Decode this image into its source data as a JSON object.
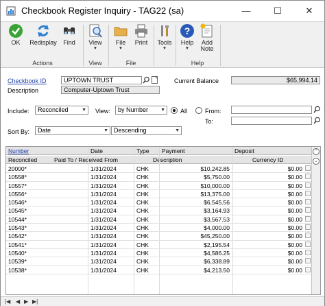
{
  "window": {
    "title": "Checkbook Register Inquiry  -  TAG22 (sa)"
  },
  "ribbon": {
    "buttons": [
      {
        "label": "OK",
        "icon": "check-icon"
      },
      {
        "label": "Redisplay",
        "icon": "refresh-icon"
      },
      {
        "label": "Find",
        "icon": "binoculars-icon"
      },
      {
        "label": "View",
        "icon": "view-icon"
      },
      {
        "label": "File",
        "icon": "folder-icon"
      },
      {
        "label": "Print",
        "icon": "printer-icon"
      },
      {
        "label": "Tools",
        "icon": "tools-icon"
      },
      {
        "label": "Help",
        "icon": "help-icon"
      },
      {
        "label": "Add",
        "label2": "Note",
        "icon": "add-note-icon"
      }
    ],
    "groups": {
      "actions": "Actions",
      "view": "View",
      "file": "File",
      "help": "Help"
    }
  },
  "form": {
    "checkbook_id_label": "Checkbook ID",
    "checkbook_id_value": "UPTOWN TRUST",
    "description_label": "Description",
    "description_value": "Computer-Uptown Trust",
    "current_balance_label": "Current Balance",
    "current_balance_value": "$65,994.14",
    "include_label": "Include:",
    "include_value": "Reconciled",
    "view_label": "View:",
    "view_value": "by Number",
    "all_label": "All",
    "from_label": "From:",
    "to_label": "To:",
    "sort_by_label": "Sort By:",
    "sort_by_value": "Date",
    "sort_order_value": "Descending"
  },
  "grid": {
    "header1": [
      "Number",
      "Date",
      "Type",
      "Payment",
      "Deposit"
    ],
    "header2": [
      "Reconciled",
      "Paid To / Received From",
      "Description",
      "Currency ID"
    ],
    "rows": [
      {
        "number": "20000*",
        "date": "1/31/2024",
        "type": "CHK",
        "payment": "$10,242.85",
        "deposit": "$0.00"
      },
      {
        "number": "10558*",
        "date": "1/31/2024",
        "type": "CHK",
        "payment": "$5,750.00",
        "deposit": "$0.00"
      },
      {
        "number": "10557*",
        "date": "1/31/2024",
        "type": "CHK",
        "payment": "$10,000.00",
        "deposit": "$0.00"
      },
      {
        "number": "10556*",
        "date": "1/31/2024",
        "type": "CHK",
        "payment": "$13,375.00",
        "deposit": "$0.00"
      },
      {
        "number": "10546*",
        "date": "1/31/2024",
        "type": "CHK",
        "payment": "$6,545.56",
        "deposit": "$0.00"
      },
      {
        "number": "10545*",
        "date": "1/31/2024",
        "type": "CHK",
        "payment": "$3,164.93",
        "deposit": "$0.00"
      },
      {
        "number": "10544*",
        "date": "1/31/2024",
        "type": "CHK",
        "payment": "$3,567.53",
        "deposit": "$0.00"
      },
      {
        "number": "10543*",
        "date": "1/31/2024",
        "type": "CHK",
        "payment": "$4,000.00",
        "deposit": "$0.00"
      },
      {
        "number": "10542*",
        "date": "1/31/2024",
        "type": "CHK",
        "payment": "$45,250.00",
        "deposit": "$0.00"
      },
      {
        "number": "10541*",
        "date": "1/31/2024",
        "type": "CHK",
        "payment": "$2,195.54",
        "deposit": "$0.00"
      },
      {
        "number": "10540*",
        "date": "1/31/2024",
        "type": "CHK",
        "payment": "$4,586.25",
        "deposit": "$0.00"
      },
      {
        "number": "10539*",
        "date": "1/31/2024",
        "type": "CHK",
        "payment": "$6,338.89",
        "deposit": "$0.00"
      },
      {
        "number": "10538*",
        "date": "1/31/2024",
        "type": "CHK",
        "payment": "$4,213.50",
        "deposit": "$0.00"
      }
    ]
  },
  "colors": {
    "link": "#1f3fa8",
    "ok_green": "#3aa335",
    "help_blue": "#2a5ab8"
  }
}
